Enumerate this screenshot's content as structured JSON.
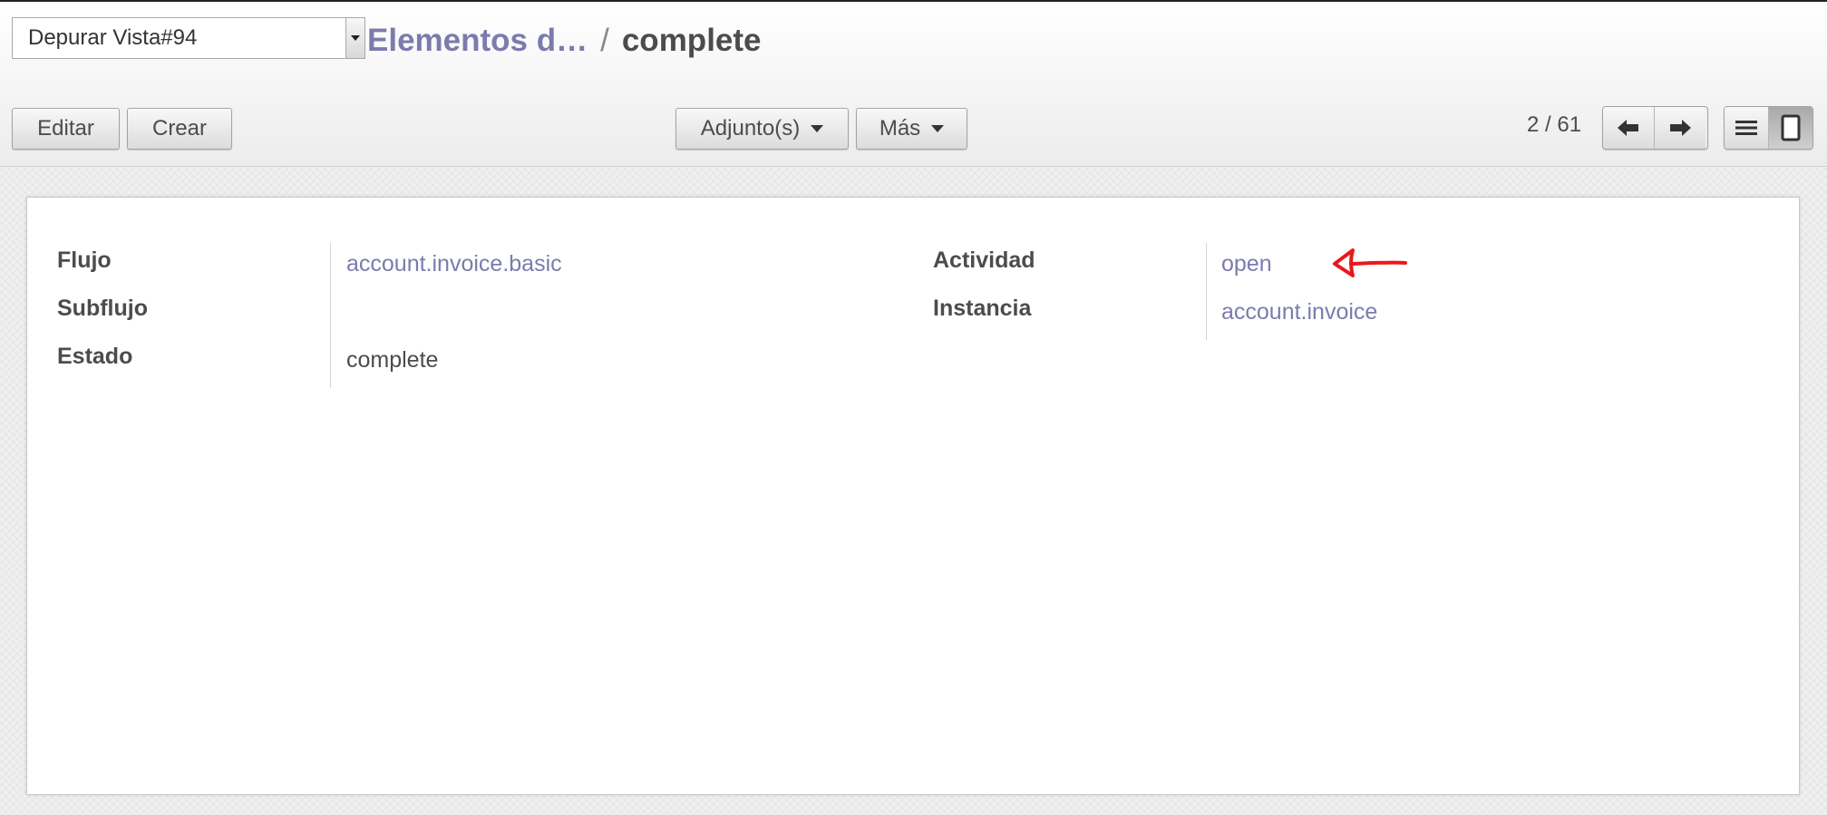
{
  "debug": {
    "select_value": "Depurar Vista#94",
    "dropdown_icon": "caret-down-icon"
  },
  "breadcrumb": {
    "parent": "Elementos d…",
    "separator": "/",
    "current": "complete"
  },
  "toolbar": {
    "edit_label": "Editar",
    "create_label": "Crear",
    "attachments_label": "Adjunto(s)",
    "more_label": "Más"
  },
  "pager": {
    "value": "2 / 61",
    "prev_icon": "arrow-left-icon",
    "next_icon": "arrow-right-icon"
  },
  "view_switcher": {
    "list_icon": "list-view-icon",
    "form_icon": "form-view-icon",
    "active": "form"
  },
  "form": {
    "left": [
      {
        "label": "Flujo",
        "value": "account.invoice.basic",
        "is_link": true
      },
      {
        "label": "Subflujo",
        "value": "",
        "is_link": false
      },
      {
        "label": "Estado",
        "value": "complete",
        "is_link": false
      }
    ],
    "right": [
      {
        "label": "Actividad",
        "value": "open",
        "is_link": true
      },
      {
        "label": "Instancia",
        "value": "account.invoice",
        "is_link": true
      }
    ]
  },
  "annotation": {
    "icon": "red-arrow-icon",
    "color": "#e8191c"
  },
  "colors": {
    "link": "#7c7bad",
    "text": "#4c4c4c"
  }
}
